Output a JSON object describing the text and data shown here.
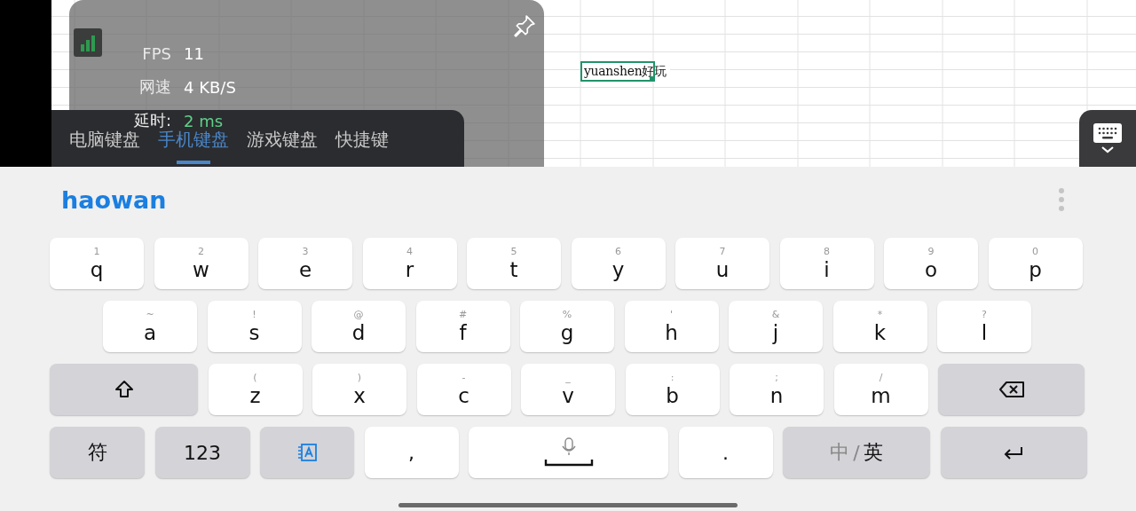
{
  "spreadsheet": {
    "cell_text": "yuanshen好玩"
  },
  "stats_panel": {
    "stats": [
      {
        "label": "FPS",
        "value": "11",
        "color": "#ffffff"
      },
      {
        "label": "网速",
        "value": "4 KB/S",
        "color": "#ffffff"
      },
      {
        "label": "延时:",
        "value": "2 ms",
        "color": "#5fd08a"
      }
    ]
  },
  "keyboard_tabs": [
    {
      "label": "电脑键盘",
      "selected": false
    },
    {
      "label": "手机键盘",
      "selected": true
    },
    {
      "label": "游戏键盘",
      "selected": false
    },
    {
      "label": "快捷键",
      "selected": false
    }
  ],
  "candidate_bar": {
    "composition": "haowan"
  },
  "keyboard_rows": [
    [
      {
        "kind": "letter",
        "label": "q",
        "hint": "1"
      },
      {
        "kind": "letter",
        "label": "w",
        "hint": "2"
      },
      {
        "kind": "letter",
        "label": "e",
        "hint": "3"
      },
      {
        "kind": "letter",
        "label": "r",
        "hint": "4"
      },
      {
        "kind": "letter",
        "label": "t",
        "hint": "5"
      },
      {
        "kind": "letter",
        "label": "y",
        "hint": "6"
      },
      {
        "kind": "letter",
        "label": "u",
        "hint": "7"
      },
      {
        "kind": "letter",
        "label": "i",
        "hint": "8"
      },
      {
        "kind": "letter",
        "label": "o",
        "hint": "9"
      },
      {
        "kind": "letter",
        "label": "p",
        "hint": "0"
      }
    ],
    [
      {
        "kind": "letter",
        "label": "a",
        "hint": "~"
      },
      {
        "kind": "letter",
        "label": "s",
        "hint": "!"
      },
      {
        "kind": "letter",
        "label": "d",
        "hint": "@"
      },
      {
        "kind": "letter",
        "label": "f",
        "hint": "#"
      },
      {
        "kind": "letter",
        "label": "g",
        "hint": "%"
      },
      {
        "kind": "letter",
        "label": "h",
        "hint": "'"
      },
      {
        "kind": "letter",
        "label": "j",
        "hint": "&"
      },
      {
        "kind": "letter",
        "label": "k",
        "hint": "*"
      },
      {
        "kind": "letter",
        "label": "l",
        "hint": "?"
      }
    ],
    [
      {
        "kind": "shift"
      },
      {
        "kind": "letter",
        "label": "z",
        "hint": "("
      },
      {
        "kind": "letter",
        "label": "x",
        "hint": ")"
      },
      {
        "kind": "letter",
        "label": "c",
        "hint": "-"
      },
      {
        "kind": "letter",
        "label": "v",
        "hint": "_"
      },
      {
        "kind": "letter",
        "label": "b",
        "hint": ":"
      },
      {
        "kind": "letter",
        "label": "n",
        "hint": ";"
      },
      {
        "kind": "letter",
        "label": "m",
        "hint": "/"
      },
      {
        "kind": "backspace"
      }
    ],
    [
      {
        "kind": "function",
        "label": "符"
      },
      {
        "kind": "function",
        "label": "123"
      },
      {
        "kind": "edit"
      },
      {
        "kind": "punct",
        "label": ","
      },
      {
        "kind": "space"
      },
      {
        "kind": "punct",
        "label": "."
      },
      {
        "kind": "lang",
        "separator": "/",
        "options": [
          {
            "label": "中",
            "selected": false
          },
          {
            "label": "英",
            "selected": true
          }
        ]
      },
      {
        "kind": "enter"
      }
    ]
  ]
}
